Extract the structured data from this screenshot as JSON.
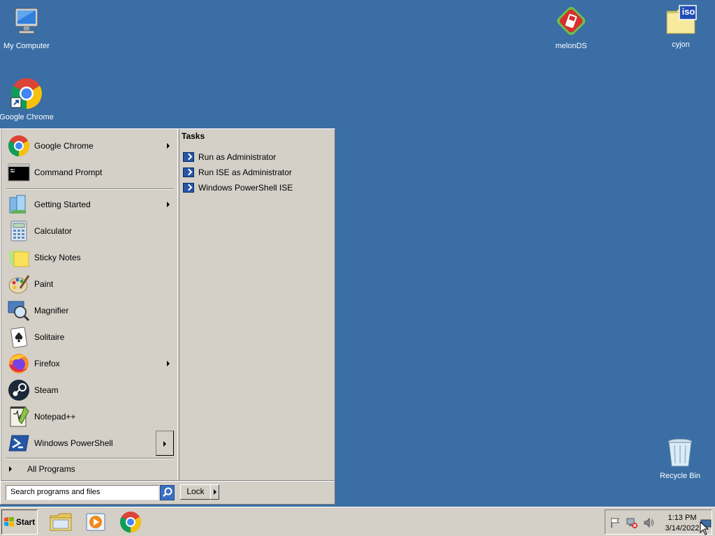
{
  "desktop": {
    "icons": [
      {
        "label": "My Computer"
      },
      {
        "label": "Google Chrome"
      },
      {
        "label": "melonDS"
      },
      {
        "label": "cyjon"
      },
      {
        "label": "Recycle Bin"
      }
    ],
    "iso_badge": "iso"
  },
  "start_menu": {
    "pinned": [
      {
        "label": "Google Chrome",
        "icon": "chrome-icon",
        "has_submenu": true
      },
      {
        "label": "Command Prompt",
        "icon": "command-prompt-icon",
        "has_submenu": false
      }
    ],
    "recent": [
      {
        "label": "Getting Started",
        "icon": "getting-started-icon",
        "has_submenu": true
      },
      {
        "label": "Calculator",
        "icon": "calculator-icon",
        "has_submenu": false
      },
      {
        "label": "Sticky Notes",
        "icon": "sticky-notes-icon",
        "has_submenu": false
      },
      {
        "label": "Paint",
        "icon": "paint-icon",
        "has_submenu": false
      },
      {
        "label": "Magnifier",
        "icon": "magnifier-icon",
        "has_submenu": false
      },
      {
        "label": "Solitaire",
        "icon": "solitaire-icon",
        "has_submenu": false
      },
      {
        "label": "Firefox",
        "icon": "firefox-icon",
        "has_submenu": true
      },
      {
        "label": "Steam",
        "icon": "steam-icon",
        "has_submenu": false
      },
      {
        "label": "Notepad++",
        "icon": "notepad-plus-plus-icon",
        "has_submenu": false
      },
      {
        "label": "Windows PowerShell",
        "icon": "powershell-icon",
        "has_submenu": true
      }
    ],
    "all_programs_label": "All Programs",
    "search_placeholder": "Search programs and files",
    "lock_label": "Lock",
    "tasks": {
      "title": "Tasks",
      "items": [
        {
          "label": "Run as Administrator"
        },
        {
          "label": "Run ISE as Administrator"
        },
        {
          "label": "Windows PowerShell ISE"
        }
      ]
    }
  },
  "taskbar": {
    "start_label": "Start",
    "pinned": [
      "explorer-icon",
      "media-player-icon",
      "chrome-icon"
    ],
    "clock": {
      "time": "1:13 PM",
      "date": "3/14/2022"
    }
  },
  "colors": {
    "desktop": "#3a6ea5",
    "menu": "#d4d0c8",
    "powershell": "#2456a5"
  }
}
